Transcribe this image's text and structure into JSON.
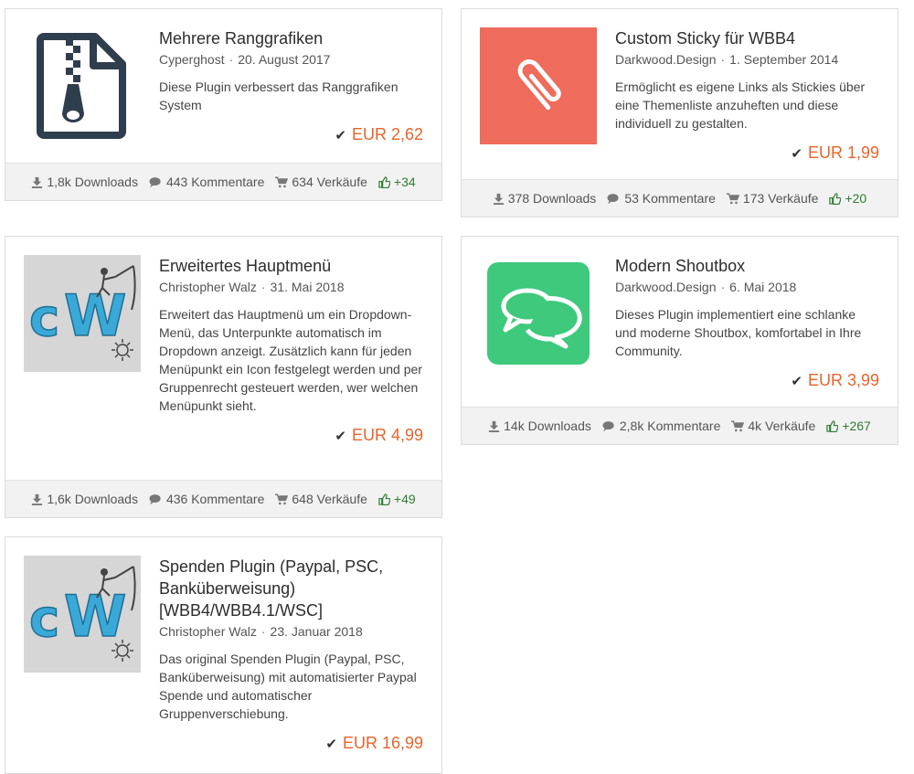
{
  "cards": [
    {
      "title": "Mehrere Ranggrafiken",
      "author": "Cyperghost",
      "date": "20. August 2017",
      "description": "Diese Plugin verbessert das Ranggrafiken System",
      "price": "EUR 2,62",
      "downloads": "1,8k Downloads",
      "comments": "443 Kommentare",
      "sales": "634 Verkäufe",
      "likes": "+34",
      "icon": "zip-file-icon"
    },
    {
      "title": "Custom Sticky für WBB4",
      "author": "Darkwood.Design",
      "date": "1. September 2014",
      "description": "Ermöglicht es eigene Links als Stickies über eine Themenliste anzuheften und diese individuell zu gestalten.",
      "price": "EUR 1,99",
      "downloads": "378 Downloads",
      "comments": "53 Kommentare",
      "sales": "173 Verkäufe",
      "likes": "+20",
      "icon": "paperclip-icon",
      "icon_bg": "#ef6b5b"
    },
    {
      "title": "Erweitertes Hauptmenü",
      "author": "Christopher Walz",
      "date": "31. Mai 2018",
      "description": "Erweitert das Hauptmenü um ein Dropdown-Menü, das Unterpunkte automatisch im Dropdown anzeigt. Zusätzlich kann für jeden Menüpunkt ein Icon festgelegt werden und per Gruppenrecht gesteuert werden, wer welchen Menüpunkt sieht.",
      "price": "EUR 4,99",
      "downloads": "1,6k Downloads",
      "comments": "436 Kommentare",
      "sales": "648 Verkäufe",
      "likes": "+49",
      "icon": "cw-logo"
    },
    {
      "title": "Modern Shoutbox",
      "author": "Darkwood.Design",
      "date": "6. Mai 2018",
      "description": "Dieses Plugin implementiert eine schlanke und moderne Shoutbox, komfortabel in Ihre Community.",
      "price": "EUR 3,99",
      "downloads": "14k Downloads",
      "comments": "2,8k Kommentare",
      "sales": "4k Verkäufe",
      "likes": "+267",
      "icon": "chat-bubbles-icon",
      "icon_bg": "#3ec97c"
    },
    {
      "title": "Spenden Plugin (Paypal, PSC, Banküberweisung) [WBB4/WBB4.1/WSC]",
      "author": "Christopher Walz",
      "date": "23. Januar 2018",
      "description": "Das original Spenden Plugin (Paypal, PSC, Banküberweisung) mit automatisierter Paypal Spende und automatischer Gruppenverschiebung.",
      "price": "EUR 16,99",
      "icon": "cw-logo"
    }
  ],
  "logo_text": {
    "c": "c",
    "w": "W"
  },
  "colors": {
    "price": "#e8632b",
    "likes": "#2e7d32"
  }
}
